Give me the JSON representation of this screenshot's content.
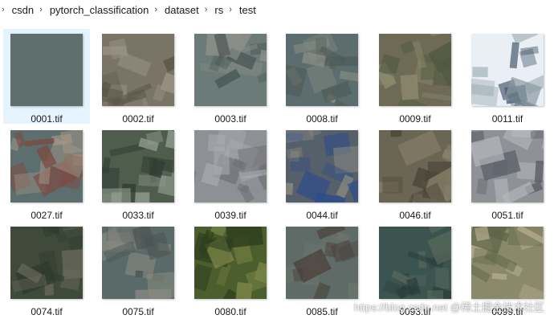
{
  "breadcrumb": [
    "csdn",
    "pytorch_classification",
    "dataset",
    "rs",
    "test"
  ],
  "files": [
    {
      "name": "0001.tif",
      "selected": true,
      "palette": [
        "#5f6f6c",
        "#637370",
        "#5b6b68"
      ]
    },
    {
      "name": "0002.tif",
      "selected": false,
      "palette": [
        "#7a7466",
        "#5a5548",
        "#9a9386"
      ]
    },
    {
      "name": "0003.tif",
      "selected": false,
      "palette": [
        "#6a7b78",
        "#8c8f88",
        "#4a5553"
      ]
    },
    {
      "name": "0008.tif",
      "selected": false,
      "palette": [
        "#5b6d6e",
        "#8a8f84",
        "#4d5a56"
      ]
    },
    {
      "name": "0009.tif",
      "selected": false,
      "palette": [
        "#6e6a55",
        "#8e8a6e",
        "#4f5a3f"
      ]
    },
    {
      "name": "0011.tif",
      "selected": false,
      "palette": [
        "#e9eff4",
        "#4a5d70",
        "#8a9aa3"
      ]
    },
    {
      "name": "0027.tif",
      "selected": false,
      "palette": [
        "#5c6f6e",
        "#a89a88",
        "#7c4a42"
      ]
    },
    {
      "name": "0033.tif",
      "selected": false,
      "palette": [
        "#4f5d4d",
        "#2f3d33",
        "#8f9a8e"
      ]
    },
    {
      "name": "0039.tif",
      "selected": false,
      "palette": [
        "#8d9094",
        "#a8abb0",
        "#6b6e72"
      ]
    },
    {
      "name": "0044.tif",
      "selected": false,
      "palette": [
        "#55606a",
        "#2e4c8a",
        "#8e8a80"
      ]
    },
    {
      "name": "0046.tif",
      "selected": false,
      "palette": [
        "#6b6654",
        "#8a826a",
        "#4a4638"
      ]
    },
    {
      "name": "0051.tif",
      "selected": false,
      "palette": [
        "#8e9196",
        "#5d6268",
        "#b6b8bc"
      ]
    },
    {
      "name": "0074.tif",
      "selected": false,
      "palette": [
        "#3f4a3a",
        "#6b6a5c",
        "#2e3a2e"
      ]
    },
    {
      "name": "0075.tif",
      "selected": false,
      "palette": [
        "#5a6a68",
        "#8a8c84",
        "#4b5553"
      ]
    },
    {
      "name": "0080.tif",
      "selected": false,
      "palette": [
        "#4d5e2e",
        "#2f3f1e",
        "#7a8448"
      ]
    },
    {
      "name": "0085.tif",
      "selected": false,
      "palette": [
        "#5e6b66",
        "#6b756e",
        "#4a3f3a"
      ]
    },
    {
      "name": "0093.tif",
      "selected": false,
      "palette": [
        "#3c5450",
        "#2b3f3a",
        "#5a6a5c"
      ]
    },
    {
      "name": "0099.tif",
      "selected": false,
      "palette": [
        "#8a8a6a",
        "#b5a98c",
        "#5d6548"
      ]
    }
  ],
  "watermark": "https://blog.csdn.net @稀土掘金技术社区"
}
